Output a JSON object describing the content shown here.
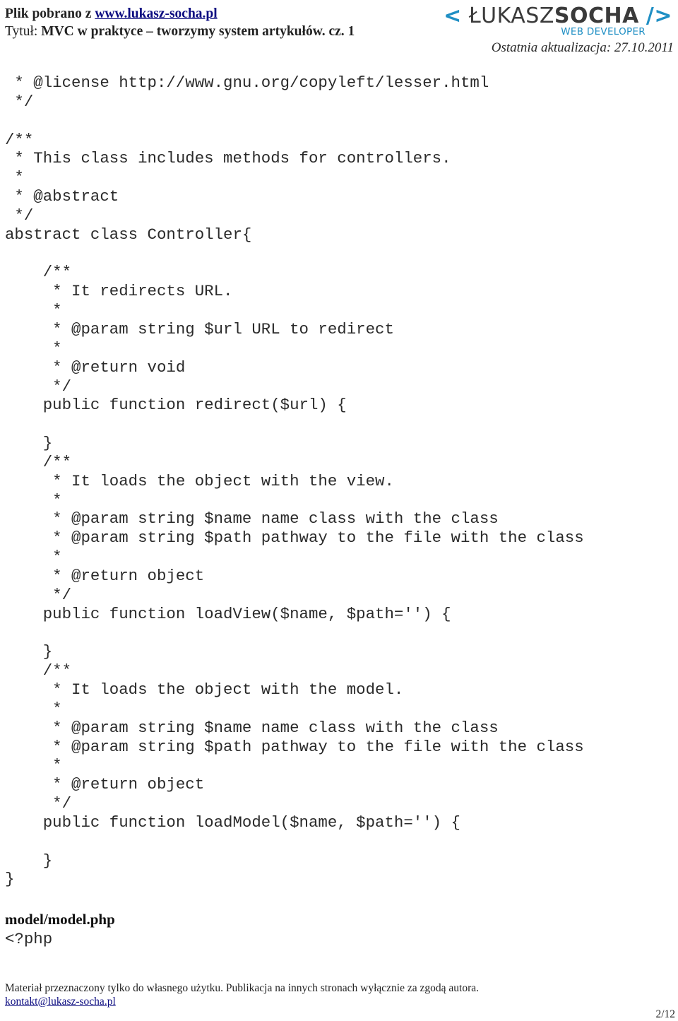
{
  "header": {
    "download_prefix": "Plik pobrano z ",
    "download_link": "www.lukasz-socha.pl",
    "title_label": "Tytuł: ",
    "title_value": "MVC w praktyce – tworzymy system artykułów. cz. 1",
    "logo": {
      "open_bracket": "<",
      "first_name": "ŁUKASZ",
      "last_name": "SOCHA",
      "close_bracket": "/>",
      "subtitle": "WEB DEVELOPER"
    },
    "last_updated": "Ostatnia aktualizacja: 27.10.2011"
  },
  "code": {
    "lines": [
      " * @license http://www.gnu.org/copyleft/lesser.html",
      " */",
      "",
      "/**",
      " * This class includes methods for controllers.",
      " *",
      " * @abstract",
      " */",
      "abstract class Controller{",
      "",
      "    /**",
      "     * It redirects URL.",
      "     *",
      "     * @param string $url URL to redirect",
      "     *",
      "     * @return void",
      "     */",
      "    public function redirect($url) {",
      "",
      "    }",
      "    /**",
      "     * It loads the object with the view.",
      "     *",
      "     * @param string $name name class with the class",
      "     * @param string $path pathway to the file with the class",
      "     *",
      "     * @return object",
      "     */",
      "    public function loadView($name, $path='') {",
      "",
      "    }",
      "    /**",
      "     * It loads the object with the model.",
      "     *",
      "     * @param string $name name class with the class",
      "     * @param string $path pathway to the file with the class",
      "     *",
      "     * @return object",
      "     */",
      "    public function loadModel($name, $path='') {",
      "",
      "    }",
      "}"
    ]
  },
  "section": {
    "filename": "model/model.php",
    "php_open": "<?php"
  },
  "footer": {
    "note": "Materiał przeznaczony tylko do własnego użytku. Publikacja na innych stronach wyłącznie za zgodą autora.",
    "email": "kontakt@lukasz-socha.pl",
    "page": "2/12"
  },
  "colors": {
    "link": "#0b0b80",
    "logo_accent": "#1f8fc4",
    "logo_dark": "#3a3a3a"
  }
}
